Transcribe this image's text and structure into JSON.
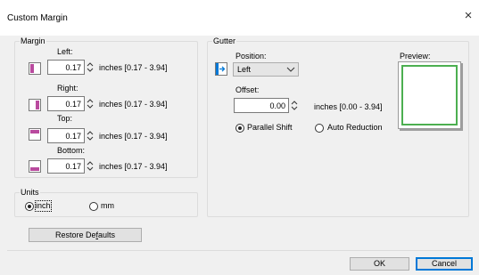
{
  "dialog": {
    "title": "Custom Margin",
    "close_glyph": "×"
  },
  "margin": {
    "legend": "Margin",
    "left": {
      "label": "Left:",
      "value": "0.17",
      "range": "inches [0.17 - 3.94]"
    },
    "right": {
      "label": "Right:",
      "value": "0.17",
      "range": "inches [0.17 - 3.94]"
    },
    "top": {
      "label": "Top:",
      "value": "0.17",
      "range": "inches [0.17 - 3.94]"
    },
    "bottom": {
      "label": "Bottom:",
      "value": "0.17",
      "range": "inches [0.17 - 3.94]"
    },
    "icon_color": "#b94a9e"
  },
  "units": {
    "legend": "Units",
    "options": [
      {
        "label": "inch",
        "selected": true
      },
      {
        "label": "mm",
        "selected": false
      }
    ]
  },
  "gutter": {
    "legend": "Gutter",
    "position_label": "Position:",
    "position_value": "Left",
    "offset_label": "Offset:",
    "offset_value": "0.00",
    "offset_range": "inches [0.00 - 3.94]",
    "modes": [
      {
        "label": "Parallel Shift",
        "selected": true
      },
      {
        "label": "Auto Reduction",
        "selected": false
      }
    ],
    "preview_label": "Preview:",
    "accent_color": "#0078d7",
    "preview_frame_color": "#4caf50"
  },
  "buttons": {
    "restore_prefix": "Restore De",
    "restore_underlined": "f",
    "restore_suffix": "aults",
    "ok": "OK",
    "cancel": "Cancel"
  }
}
